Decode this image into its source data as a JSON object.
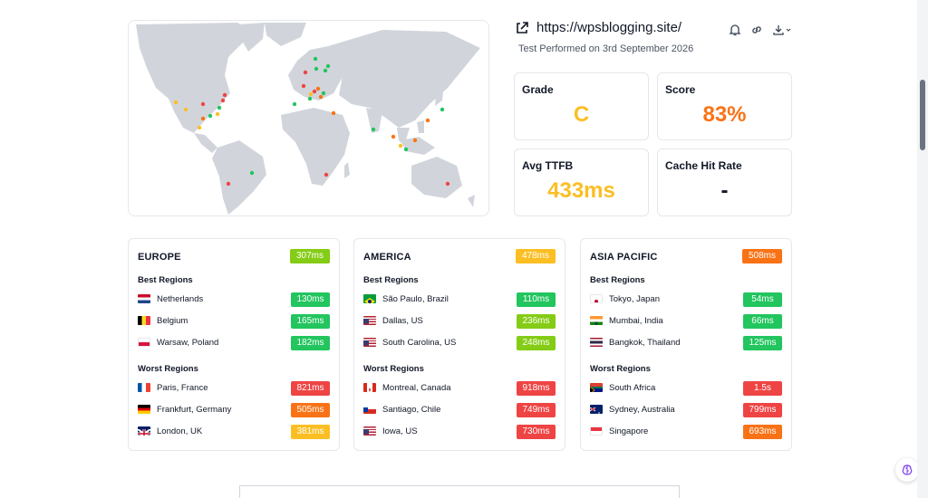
{
  "site": {
    "url": "https://wpsblogging.site/",
    "test_date": "Test Performed on 3rd September 2026"
  },
  "metrics": {
    "grade": {
      "label": "Grade",
      "value": "C",
      "color": "#fbbf24"
    },
    "score": {
      "label": "Score",
      "value": "83%",
      "color": "#f97316"
    },
    "ttfb": {
      "label": "Avg TTFB",
      "value": "433ms",
      "color": "#fbbf24"
    },
    "cache": {
      "label": "Cache Hit Rate",
      "value": "-",
      "color": "#111827"
    }
  },
  "colors": {
    "green": "#22c55e",
    "lightgreen": "#84cc16",
    "yellow": "#fbbf24",
    "orange": "#f97316",
    "red": "#ef4444"
  },
  "regions": {
    "europe": {
      "title": "EUROPE",
      "avg": "307ms",
      "best_label": "Best Regions",
      "worst_label": "Worst Regions",
      "best": [
        {
          "name": "Netherlands",
          "ms": "130ms"
        },
        {
          "name": "Belgium",
          "ms": "165ms"
        },
        {
          "name": "Warsaw, Poland",
          "ms": "182ms"
        }
      ],
      "worst": [
        {
          "name": "Paris, France",
          "ms": "821ms"
        },
        {
          "name": "Frankfurt, Germany",
          "ms": "505ms"
        },
        {
          "name": "London, UK",
          "ms": "381ms"
        }
      ]
    },
    "america": {
      "title": "AMERICA",
      "avg": "478ms",
      "best_label": "Best Regions",
      "worst_label": "Worst Regions",
      "best": [
        {
          "name": "São Paulo, Brazil",
          "ms": "110ms"
        },
        {
          "name": "Dallas, US",
          "ms": "236ms"
        },
        {
          "name": "South Carolina, US",
          "ms": "248ms"
        }
      ],
      "worst": [
        {
          "name": "Montreal, Canada",
          "ms": "918ms"
        },
        {
          "name": "Santiago, Chile",
          "ms": "749ms"
        },
        {
          "name": "Iowa, US",
          "ms": "730ms"
        }
      ]
    },
    "asia": {
      "title": "ASIA PACIFIC",
      "avg": "508ms",
      "best_label": "Best Regions",
      "worst_label": "Worst Regions",
      "best": [
        {
          "name": "Tokyo, Japan",
          "ms": "54ms"
        },
        {
          "name": "Mumbai, India",
          "ms": "66ms"
        },
        {
          "name": "Bangkok, Thailand",
          "ms": "125ms"
        }
      ],
      "worst": [
        {
          "name": "South Africa",
          "ms": "1.5s"
        },
        {
          "name": "Sydney, Australia",
          "ms": "799ms"
        },
        {
          "name": "Singapore",
          "ms": "693ms"
        }
      ]
    }
  }
}
